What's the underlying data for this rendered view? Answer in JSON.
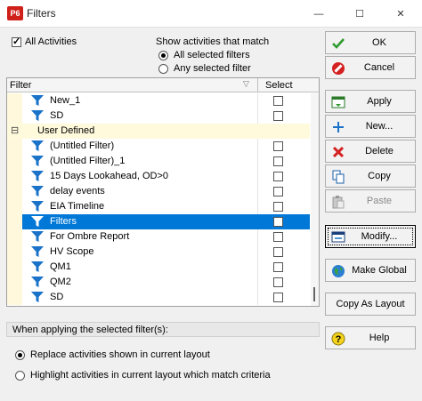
{
  "window": {
    "icon_text": "P6",
    "title": "Filters",
    "minimize_glyph": "—",
    "maximize_glyph": "☐",
    "close_glyph": "✕"
  },
  "options": {
    "all_activities_label": "All Activities",
    "all_activities_checked": true,
    "show_match_title": "Show activities that match",
    "match_options": [
      {
        "label": "All selected filters",
        "selected": true
      },
      {
        "label": "Any selected filter",
        "selected": false
      }
    ]
  },
  "grid": {
    "col_filter": "Filter",
    "col_select": "Select",
    "rows": [
      {
        "label": "New_1",
        "type": "filter"
      },
      {
        "label": "SD",
        "type": "filter"
      },
      {
        "label": "User Defined",
        "type": "group",
        "expand": "⊟"
      },
      {
        "label": "(Untitled Filter)",
        "type": "filter"
      },
      {
        "label": "(Untitled Filter)_1",
        "type": "filter"
      },
      {
        "label": "15 Days Lookahead, OD>0",
        "type": "filter"
      },
      {
        "label": "delay events",
        "type": "filter"
      },
      {
        "label": "EIA Timeline",
        "type": "filter"
      },
      {
        "label": "Filters",
        "type": "filter",
        "selected": true
      },
      {
        "label": "For Ombre Report",
        "type": "filter"
      },
      {
        "label": "HV Scope",
        "type": "filter"
      },
      {
        "label": "QM1",
        "type": "filter"
      },
      {
        "label": "QM2",
        "type": "filter"
      },
      {
        "label": "SD",
        "type": "filter"
      }
    ]
  },
  "apply_section": {
    "title": "When applying the selected filter(s):",
    "options": [
      {
        "label": "Replace activities shown in current layout",
        "selected": true
      },
      {
        "label": "Highlight activities in current layout which match criteria",
        "selected": false
      }
    ]
  },
  "buttons": {
    "ok": "OK",
    "cancel": "Cancel",
    "apply": "Apply",
    "new": "New...",
    "delete": "Delete",
    "copy": "Copy",
    "paste": "Paste",
    "modify": "Modify...",
    "make_global": "Make Global",
    "copy_as_layout": "Copy As Layout",
    "help": "Help"
  },
  "colors": {
    "selection": "#0078d7",
    "filter_icon": "#1a73c9",
    "group_row": "#fffadc",
    "ok_check": "#2e9b2e",
    "cancel_red": "#d42020"
  }
}
